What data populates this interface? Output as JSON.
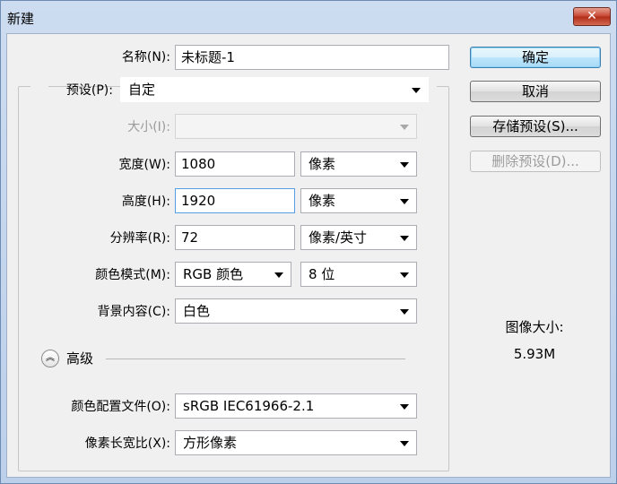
{
  "window": {
    "title": "新建"
  },
  "form": {
    "name_label": "名称(N):",
    "name_value": "未标题-1",
    "preset_label": "预设(P):",
    "preset_value": "自定",
    "size_label": "大小(I):",
    "size_value": "",
    "width_label": "宽度(W):",
    "width_value": "1080",
    "width_unit": "像素",
    "height_label": "高度(H):",
    "height_value": "1920",
    "height_unit": "像素",
    "resolution_label": "分辨率(R):",
    "resolution_value": "72",
    "resolution_unit": "像素/英寸",
    "color_mode_label": "颜色模式(M):",
    "color_mode_value": "RGB 颜色",
    "bit_depth_value": "8 位",
    "background_label": "背景内容(C):",
    "background_value": "白色",
    "advanced_label": "高级",
    "color_profile_label": "颜色配置文件(O):",
    "color_profile_value": "sRGB IEC61966-2.1",
    "pixel_aspect_label": "像素长宽比(X):",
    "pixel_aspect_value": "方形像素"
  },
  "buttons": {
    "ok": "确定",
    "cancel": "取消",
    "save_preset": "存储预设(S)...",
    "delete_preset": "删除预设(D)..."
  },
  "info": {
    "image_size_label": "图像大小:",
    "image_size_value": "5.93M"
  },
  "icons": {
    "close": "close-icon",
    "dropdown": "chevron-down-icon",
    "advanced": "double-chevron-up-icon"
  }
}
